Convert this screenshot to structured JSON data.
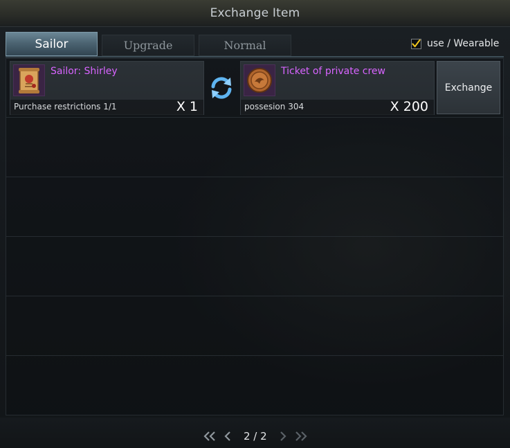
{
  "window": {
    "title": "Exchange Item"
  },
  "tabs": [
    {
      "label": "Sailor",
      "active": true
    },
    {
      "label": "Upgrade",
      "active": false
    },
    {
      "label": "Normal",
      "active": false
    }
  ],
  "filter": {
    "label": "use / Wearable",
    "checked": true
  },
  "exchange_rows": [
    {
      "reward": {
        "name": "Sailor: Shirley",
        "note": "Purchase restrictions 1/1",
        "quantity": "X 1",
        "icon": "sailor-scroll-icon"
      },
      "cost": {
        "name": "Ticket of private crew",
        "note": "possesion 304",
        "quantity": "X 200",
        "icon": "crew-ticket-coin-icon"
      },
      "swap_icon": "swap-arrows-icon",
      "button_label": "Exchange"
    }
  ],
  "pagination": {
    "text": "2 / 2"
  },
  "colors": {
    "item_name": "#d864ff",
    "active_tab": "#4c6472",
    "swap_icon": "#5fb4f0"
  }
}
